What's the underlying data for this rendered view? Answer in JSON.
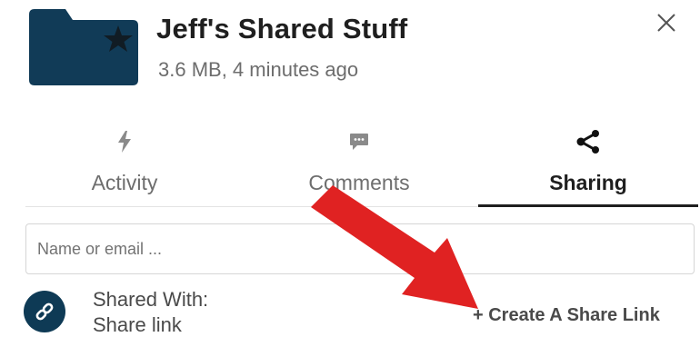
{
  "header": {
    "title": "Jeff's Shared Stuff",
    "subtitle": "3.6 MB, 4 minutes ago",
    "close_symbol": "✕",
    "folder_icon": "folder-star-icon",
    "folder_color": "#113b57"
  },
  "tabs": [
    {
      "label": "Activity",
      "icon": "lightning-icon",
      "active": false
    },
    {
      "label": "Comments",
      "icon": "comment-icon",
      "active": false
    },
    {
      "label": "Sharing",
      "icon": "share-icon",
      "active": true
    }
  ],
  "share": {
    "placeholder": "Name or email ...",
    "value": "",
    "shared_with_label": "Shared With:",
    "share_link_label": "Share link",
    "create_link_label": "+ Create A Share Link",
    "link_icon": "link-icon"
  },
  "annotation": {
    "arrow_color": "#e02222",
    "arrow_icon": "arrow-icon"
  }
}
